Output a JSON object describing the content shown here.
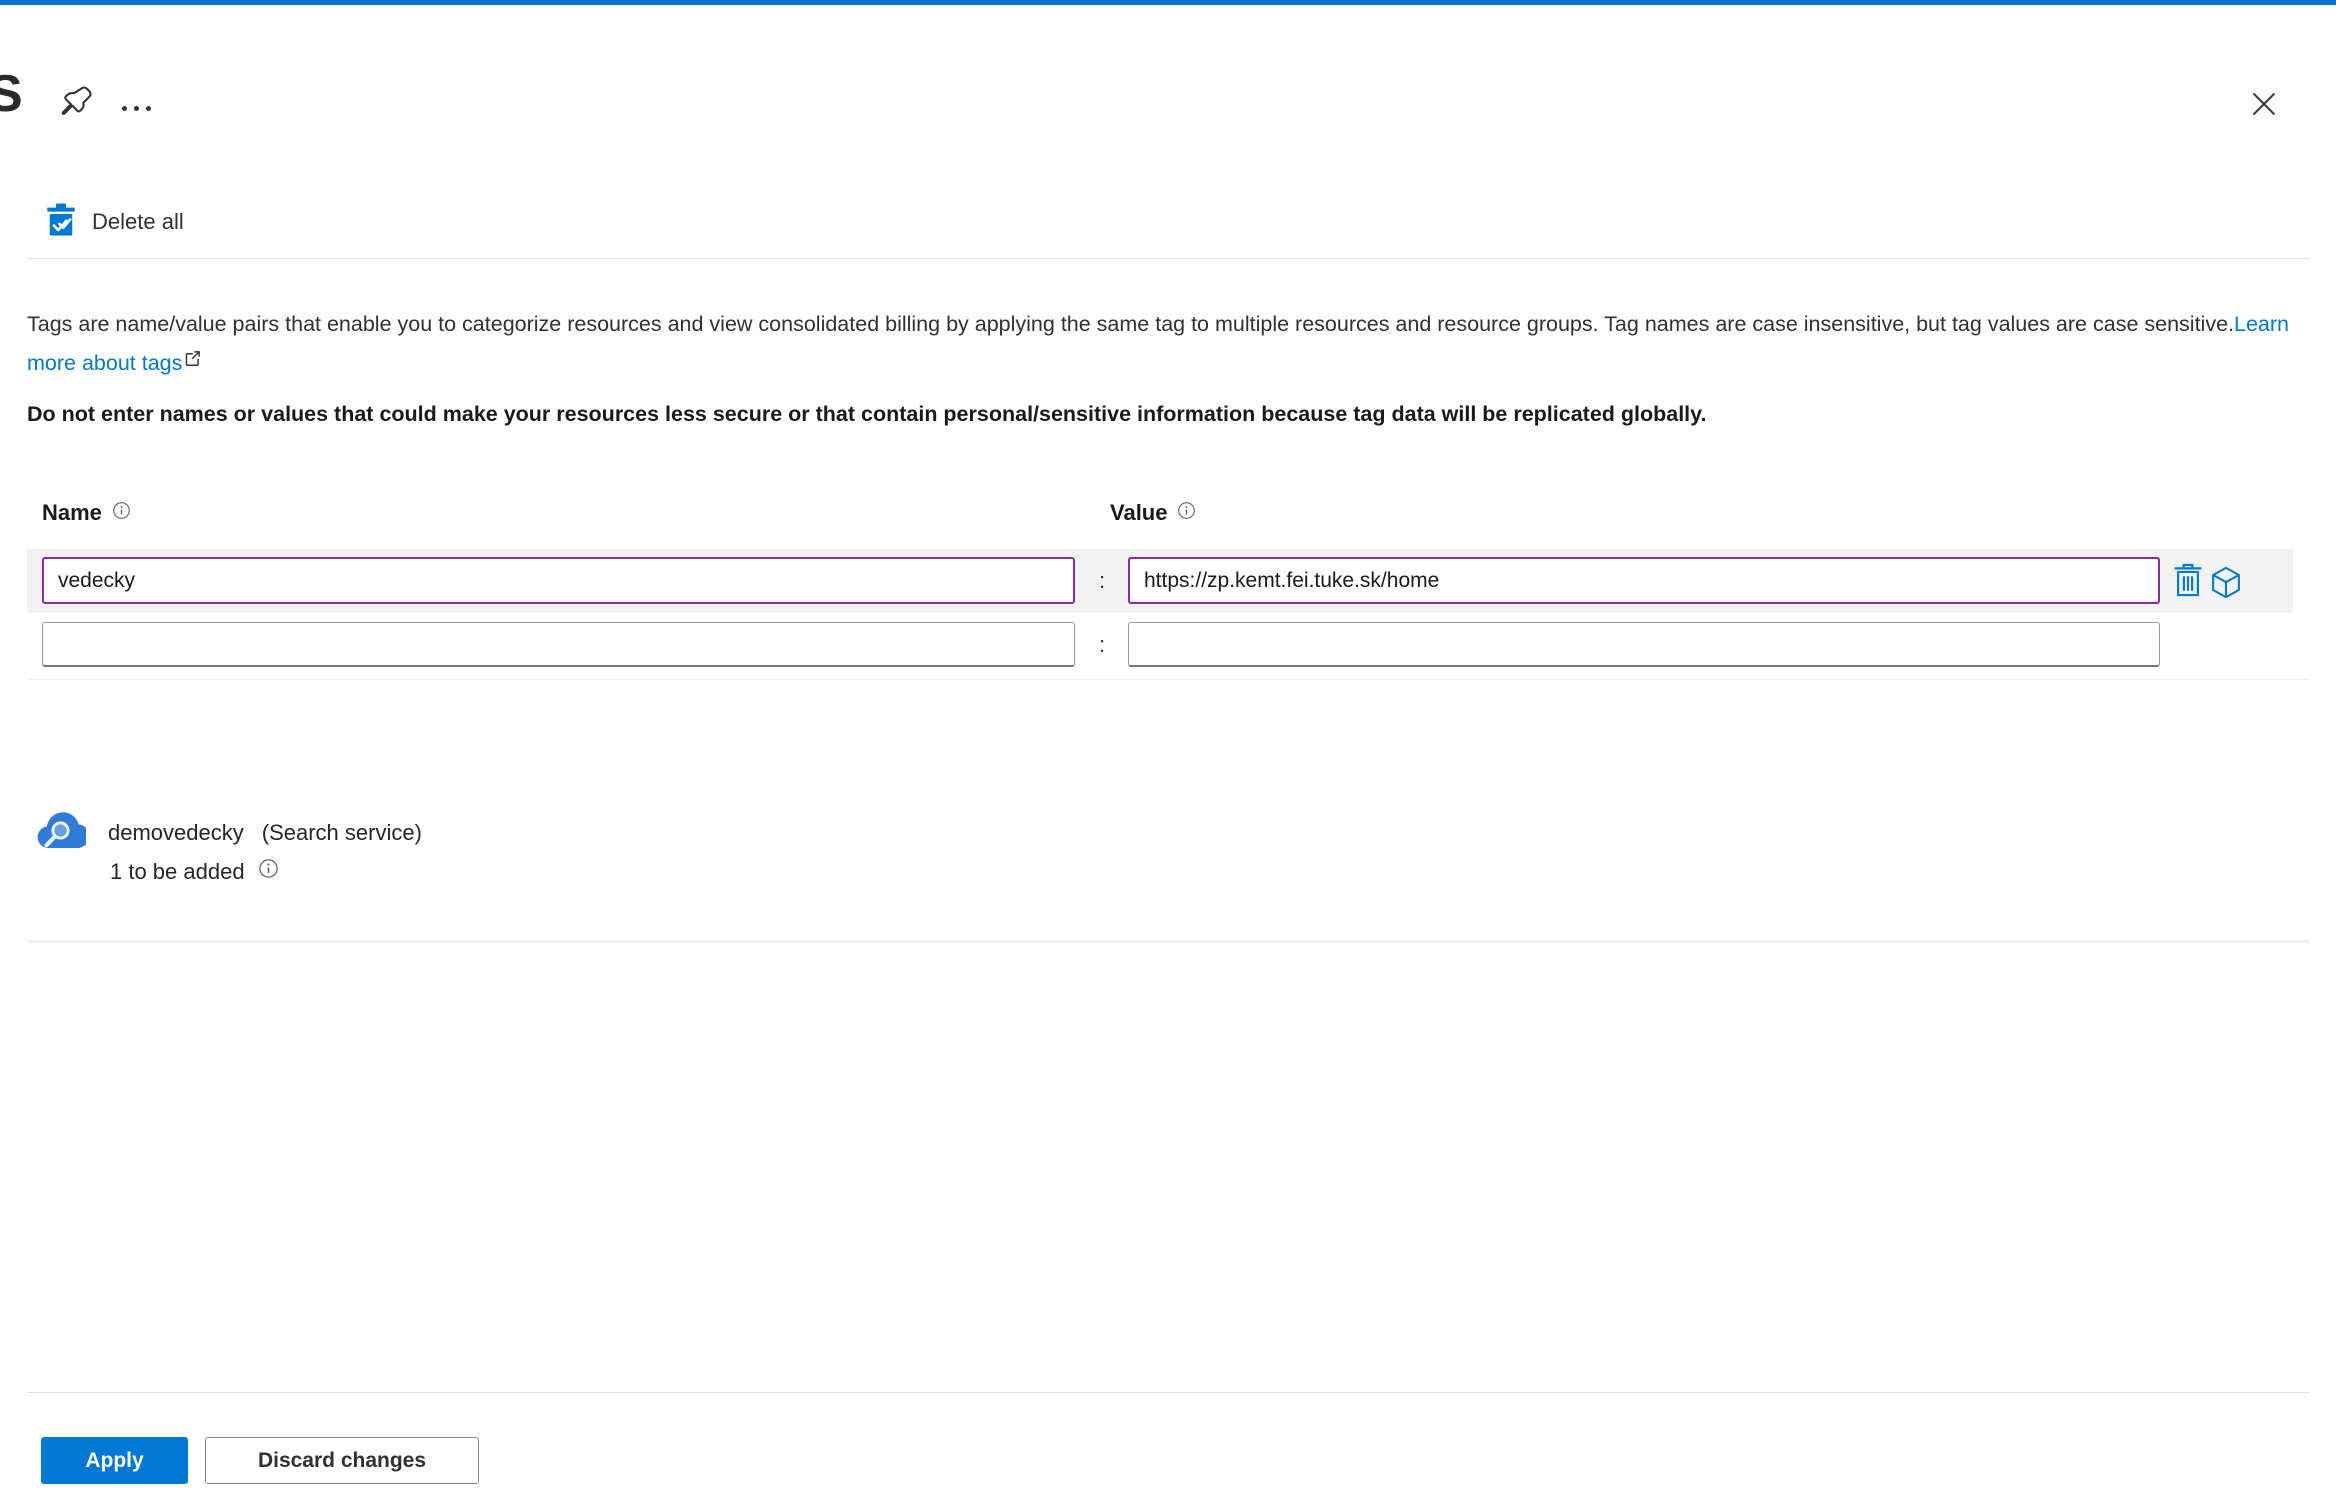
{
  "page": {
    "title_partial": "S"
  },
  "toolbar": {
    "delete_all_label": "Delete all"
  },
  "description": {
    "text": "Tags are name/value pairs that enable you to categorize resources and view consolidated billing by applying the same tag to multiple resources and resource groups. Tag names are case insensitive, but tag values are case sensitive.",
    "link_label": "Learn more about tags",
    "warning": "Do not enter names or values that could make your resources less secure or that contain personal/sensitive information because tag data will be replicated globally."
  },
  "tags_table": {
    "name_header": "Name",
    "value_header": "Value",
    "separator": ":",
    "rows": [
      {
        "name": "vedecky",
        "value": "https://zp.kemt.fei.tuke.sk/home",
        "modified": true
      },
      {
        "name": "",
        "value": "",
        "modified": false
      }
    ]
  },
  "resource": {
    "name": "demovedecky",
    "type": "(Search service)",
    "status": "1 to be added"
  },
  "footer": {
    "apply_label": "Apply",
    "discard_label": "Discard changes"
  },
  "icons": {
    "pin": "pin-icon",
    "more": "more-ellipsis-icon",
    "close": "close-icon",
    "delete_all": "delete-all-checked-trash-icon",
    "info": "info-icon",
    "external_link": "external-link-icon",
    "trash": "trash-icon",
    "cube": "resource-cube-icon",
    "search_service": "search-service-cloud-icon"
  },
  "colors": {
    "accent_blue": "#0078d4",
    "modified_purple": "#8a2da5",
    "row_highlight": "#f2f2f2",
    "link_blue": "#0078d4",
    "text": "#323130"
  }
}
